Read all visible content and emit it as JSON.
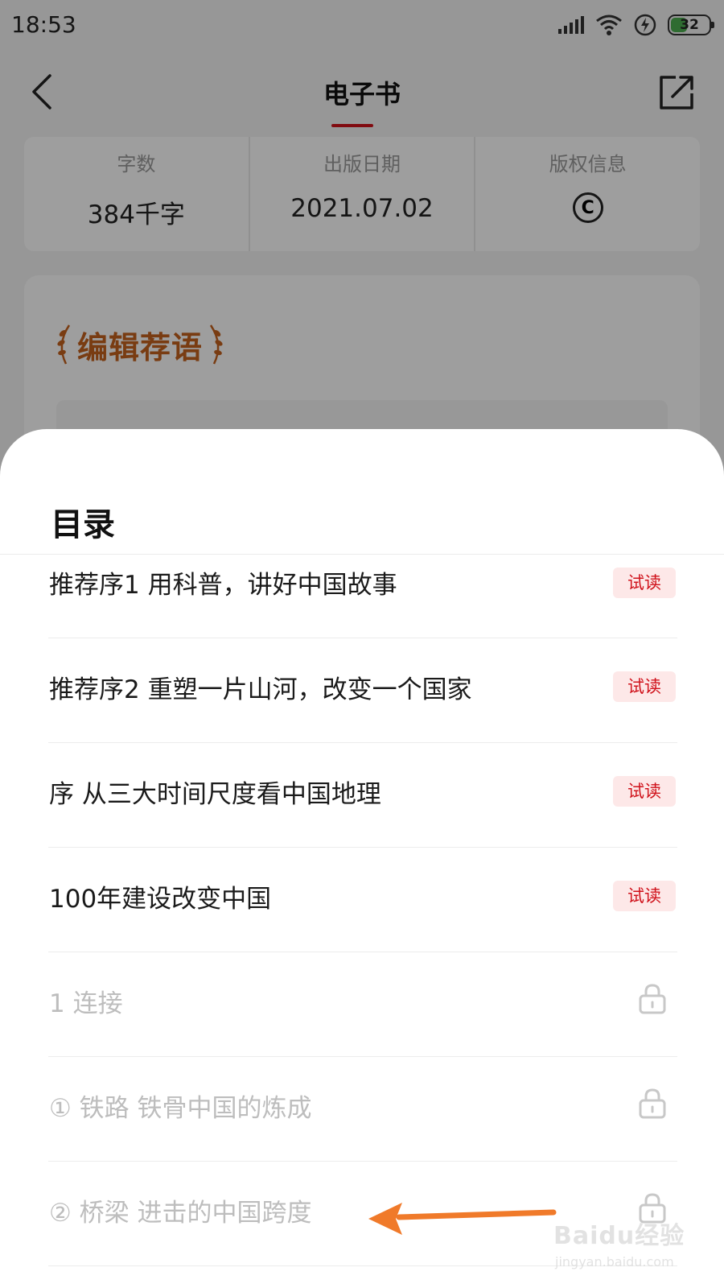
{
  "status_bar": {
    "time": "18:53",
    "battery": "32"
  },
  "header": {
    "title": "电子书"
  },
  "stats": [
    {
      "label": "字数",
      "value": "384千字"
    },
    {
      "label": "出版日期",
      "value": "2021.07.02"
    },
    {
      "label": "版权信息",
      "icon": "copyright-icon"
    }
  ],
  "recommend": {
    "title": "编辑荐语"
  },
  "toc": {
    "title": "目录",
    "items": [
      {
        "text": "推荐序1 用科普，讲好中国故事",
        "badge": "试读",
        "locked": false
      },
      {
        "text": "推荐序2 重塑一片山河，改变一个国家",
        "badge": "试读",
        "locked": false
      },
      {
        "text": "序 从三大时间尺度看中国地理",
        "badge": "试读",
        "locked": false
      },
      {
        "text": "100年建设改变中国",
        "badge": "试读",
        "locked": false
      },
      {
        "text": "1 连接",
        "icon": "lock-icon",
        "locked": true
      },
      {
        "text": "① 铁路 铁骨中国的炼成",
        "icon": "lock-icon",
        "locked": true
      },
      {
        "text": "② 桥梁 进击的中国跨度",
        "icon": "lock-icon",
        "locked": true
      }
    ]
  },
  "watermark": {
    "brand": "Baidu经验",
    "url": "jingyan.baidu.com"
  },
  "colors": {
    "accent": "#d0121b",
    "arrow": "#f07a2a",
    "recommend_title": "#c4621e",
    "badge_bg": "#fde8e8"
  }
}
